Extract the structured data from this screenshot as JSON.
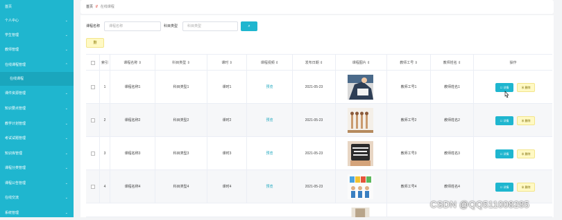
{
  "sidebar": {
    "items": [
      {
        "label": "首页",
        "chevron": ""
      },
      {
        "label": "个人中心",
        "chevron": "⌄"
      },
      {
        "label": "学生管理",
        "chevron": "⌄"
      },
      {
        "label": "教师管理",
        "chevron": "⌄"
      },
      {
        "label": "在线课程管理",
        "chevron": "⌃"
      },
      {
        "label": "在线课程",
        "chevron": ""
      },
      {
        "label": "课件资源管理",
        "chevron": "⌄"
      },
      {
        "label": "知识要点管理",
        "chevron": "⌄"
      },
      {
        "label": "教学计划管理",
        "chevron": "⌄"
      },
      {
        "label": "考试试题管理",
        "chevron": "⌄"
      },
      {
        "label": "知识库管理",
        "chevron": "⌄"
      },
      {
        "label": "课程分类管理",
        "chevron": "⌄"
      },
      {
        "label": "课程公告管理",
        "chevron": "⌄"
      },
      {
        "label": "在线交流",
        "chevron": "⌄"
      },
      {
        "label": "系统管理",
        "chevron": "⌄"
      }
    ]
  },
  "breadcrumb": {
    "home": "首页",
    "sep": "//",
    "current": "在线课程"
  },
  "filters": {
    "course_name_label": "课程名称",
    "course_name_placeholder": "课程名称",
    "subject_type_label": "科目类型",
    "subject_type_placeholder": "科目类型",
    "search_icon": "⌕",
    "delete_label": "删"
  },
  "table": {
    "columns": [
      "",
      "索引",
      "课程名称 ⇕",
      "科目类型 ⇕",
      "课时 ⇕",
      "课程视频 ⇕",
      "发布日期 ⇕",
      "课程图片 ⇕",
      "教师工号 ⇕",
      "教师姓名 ⇕",
      "操作"
    ],
    "rows": [
      {
        "idx": "1",
        "name": "课程名称1",
        "type": "科目类型1",
        "hours": "课时1",
        "video": "预览",
        "date": "2021-05-23",
        "tid": "教师工号1",
        "tname": "教师姓名1",
        "edit": "☐ 详情",
        "del": "⊗ 删除"
      },
      {
        "idx": "2",
        "name": "课程名称2",
        "type": "科目类型2",
        "hours": "课时2",
        "video": "预览",
        "date": "2021-05-23",
        "tid": "教师工号2",
        "tname": "教师姓名2",
        "edit": "☐ 详情",
        "del": "⊗ 删除"
      },
      {
        "idx": "3",
        "name": "课程名称3",
        "type": "科目类型3",
        "hours": "课时3",
        "video": "预览",
        "date": "2021-05-23",
        "tid": "教师工号3",
        "tname": "教师姓名3",
        "edit": "☐ 详情",
        "del": "⊗ 删除"
      },
      {
        "idx": "4",
        "name": "课程名称4",
        "type": "科目类型4",
        "hours": "课时4",
        "video": "预览",
        "date": "2021-05-23",
        "tid": "教师工号4",
        "tname": "教师姓名4",
        "edit": "☐ 详情",
        "del": "⊗ 删除"
      }
    ]
  },
  "watermark": "CSDN @QQ511008285",
  "colors": {
    "accent": "#1fb6cf",
    "warn_bg": "#fff9c4",
    "link": "#1aa6bd",
    "sep": "#e24a3b"
  }
}
